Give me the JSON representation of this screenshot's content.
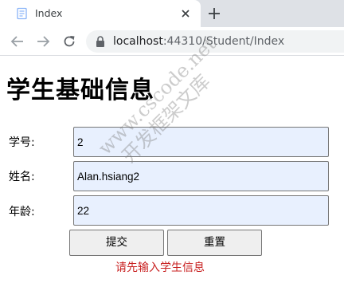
{
  "browser": {
    "tab_title": "Index",
    "url_host": "localhost",
    "url_rest": ":44310/Student/Index"
  },
  "page": {
    "title": "学生基础信息"
  },
  "form": {
    "id_label": "学号:",
    "id_value": "2",
    "name_label": "姓名:",
    "name_value": "Alan.hsiang2",
    "age_label": "年龄:",
    "age_value": "22",
    "submit_label": "提交",
    "reset_label": "重置",
    "message": "请先输入学生信息"
  },
  "watermark": {
    "line1": "www.cscode.net",
    "line2": "开发框架文库"
  },
  "colors": {
    "tab_strip": "#dee1e6",
    "input_fill": "#e8f0fe",
    "message": "#c82020"
  },
  "icons": [
    "page-favicon-icon",
    "close-icon",
    "plus-icon",
    "back-arrow-icon",
    "forward-arrow-icon",
    "reload-icon",
    "lock-icon"
  ]
}
